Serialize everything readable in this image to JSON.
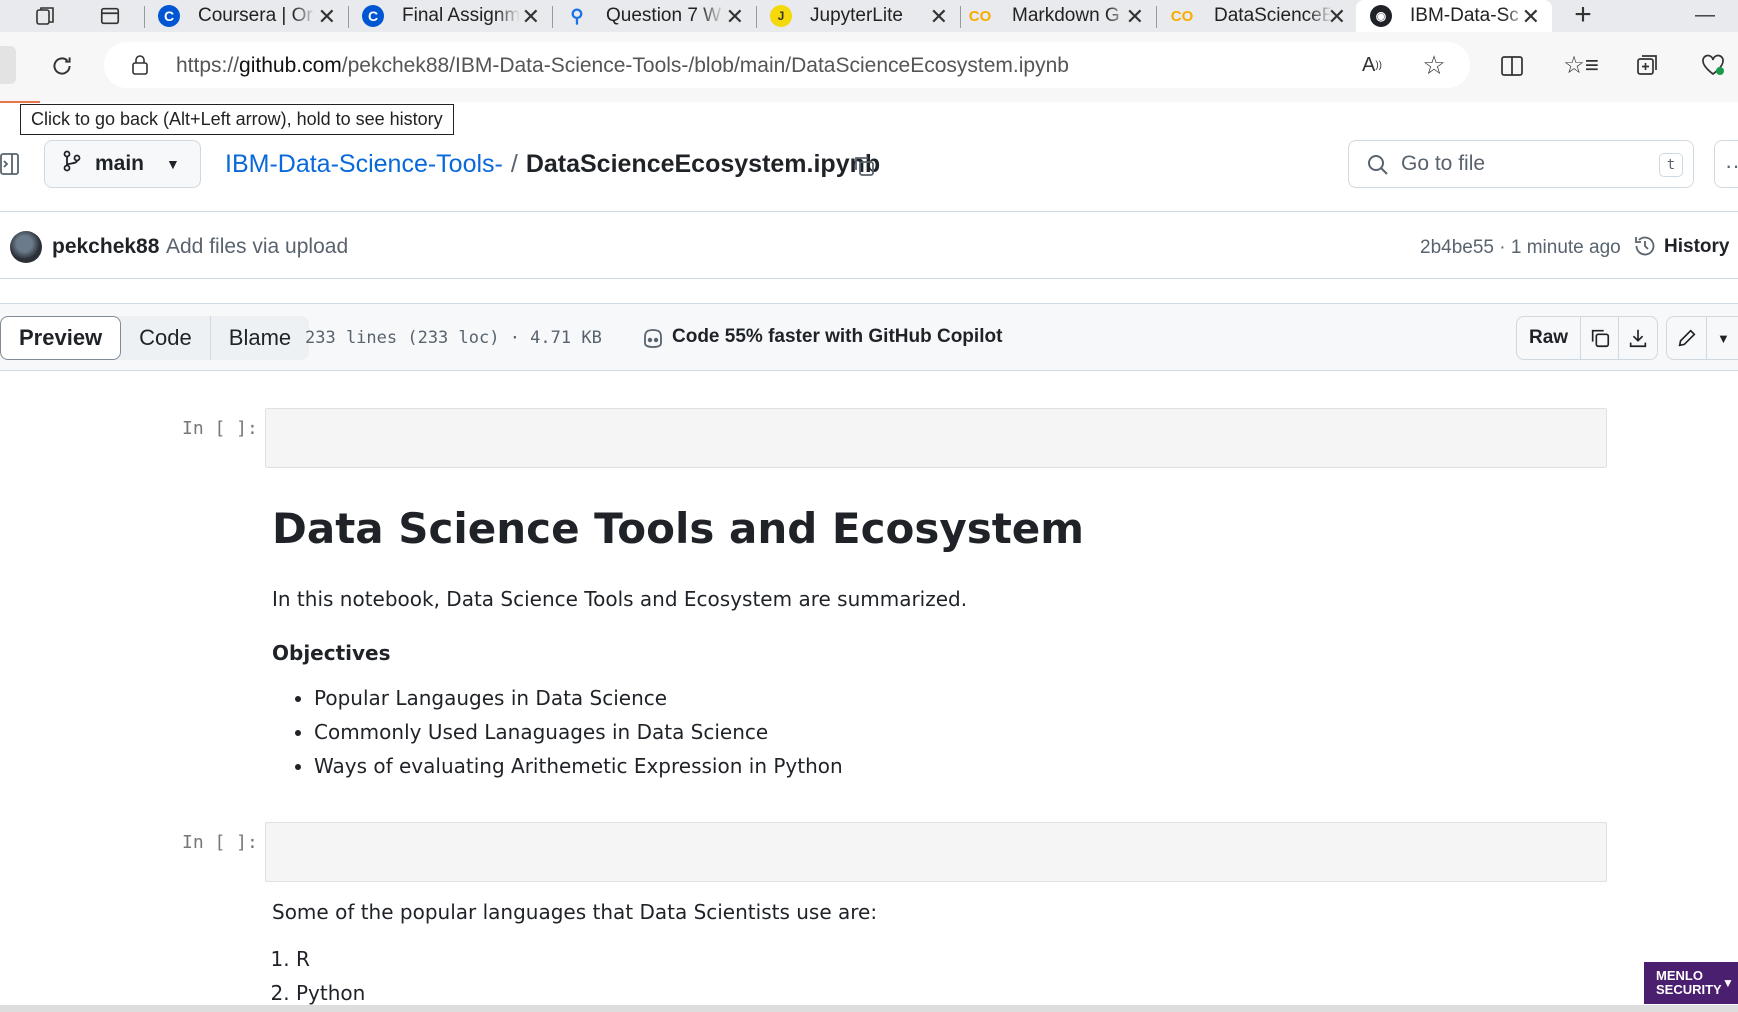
{
  "browser": {
    "tabs": [
      {
        "label": "Coursera | Or",
        "icon": "coursera-icon"
      },
      {
        "label": "Final Assignm",
        "icon": "coursera-icon"
      },
      {
        "label": "Question 7 W",
        "icon": "search-icon"
      },
      {
        "label": "JupyterLite",
        "icon": "jupyterlite-icon"
      },
      {
        "label": "Markdown G",
        "icon": "colab-icon"
      },
      {
        "label": "DataScienceE",
        "icon": "colab-icon"
      },
      {
        "label": "IBM-Data-Sc",
        "icon": "github-icon",
        "active": true
      }
    ],
    "url_prefix": "https://",
    "url_host": "github.com",
    "url_path": "/pekchek88/IBM-Data-Science-Tools-/blob/main/DataScienceEcosystem.ipynb",
    "tooltip": "Click to go back (Alt+Left arrow), hold to see history"
  },
  "repo": {
    "branch": "main",
    "name": "IBM-Data-Science-Tools-",
    "separator": "/",
    "file": "DataScienceEcosystem.ipynb",
    "goto_placeholder": "Go to file",
    "goto_key": "t"
  },
  "commit": {
    "author": "pekchek88",
    "message": "Add files via upload",
    "hash_time": "2b4be55 · 1 minute ago",
    "history": "History"
  },
  "toolbar": {
    "preview": "Preview",
    "code": "Code",
    "blame": "Blame",
    "stats": "233 lines (233 loc) · 4.71 KB",
    "copilot": "Code 55% faster with GitHub Copilot",
    "raw": "Raw"
  },
  "notebook": {
    "prompt1": "In [ ]:",
    "title": "Data Science Tools and Ecosystem",
    "intro": "In this notebook, Data Science Tools and Ecosystem are summarized.",
    "objectives_heading": "Objectives",
    "objectives": [
      "Popular Langauges in Data Science",
      "Commonly Used Lanaguages in Data Science",
      "Ways of evaluating Arithemetic Expression in Python"
    ],
    "prompt2": "In [ ]:",
    "languages_intro": "Some of the popular languages that Data Scientists use are:",
    "languages": [
      "R",
      "Python"
    ]
  },
  "security_badge": "MENLO SECURITY"
}
